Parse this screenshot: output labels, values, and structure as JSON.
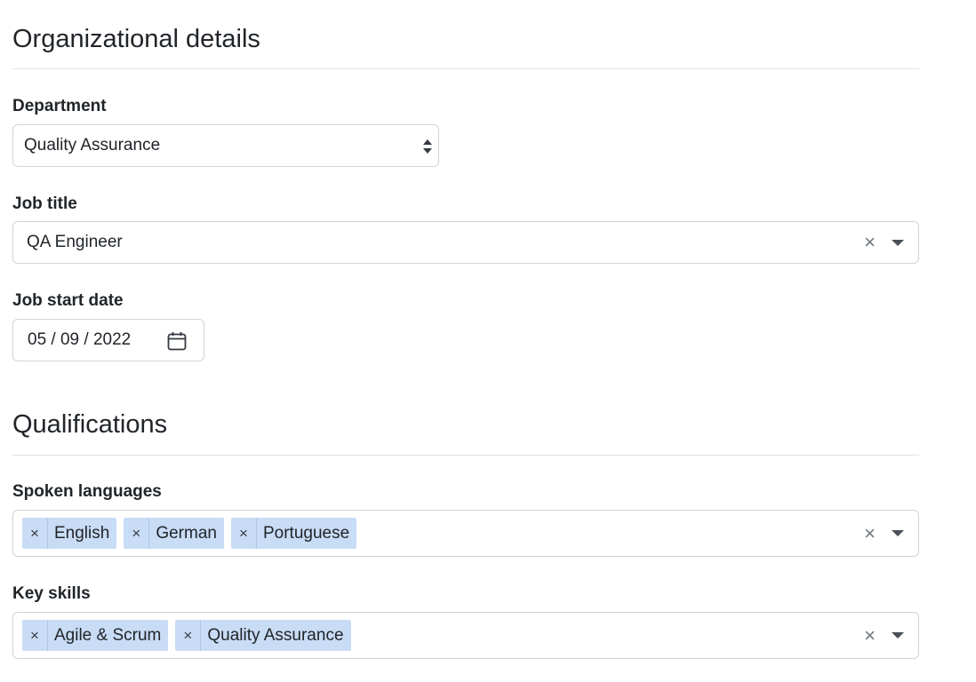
{
  "organizational": {
    "title": "Organizational details",
    "department": {
      "label": "Department",
      "selected": "Quality Assurance"
    },
    "job_title": {
      "label": "Job title",
      "value": "QA Engineer",
      "clear_glyph": "×"
    },
    "job_start_date": {
      "label": "Job start date",
      "value": "05 / 09 / 2022"
    }
  },
  "qualifications": {
    "title": "Qualifications",
    "spoken_languages": {
      "label": "Spoken languages",
      "clear_glyph": "×",
      "chips": [
        {
          "remove": "×",
          "label": "English"
        },
        {
          "remove": "×",
          "label": "German"
        },
        {
          "remove": "×",
          "label": "Portuguese"
        }
      ]
    },
    "key_skills": {
      "label": "Key skills",
      "clear_glyph": "×",
      "chips": [
        {
          "remove": "×",
          "label": "Agile & Scrum"
        },
        {
          "remove": "×",
          "label": "Quality Assurance"
        }
      ]
    }
  },
  "colors": {
    "chip_background": "#c9dcf6",
    "border": "#ced4da",
    "rule": "#dee2e6"
  },
  "icons": {
    "select_arrows": "updown-arrows-icon",
    "clear": "close-icon",
    "dropdown": "caret-down-icon",
    "calendar": "calendar-icon"
  }
}
